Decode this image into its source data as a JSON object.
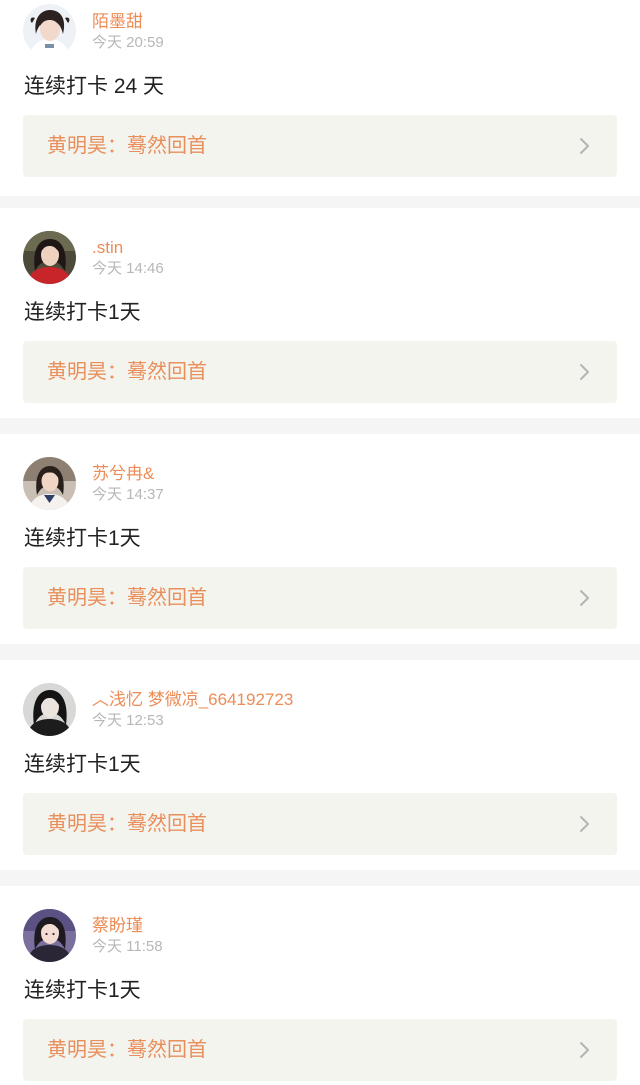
{
  "posts": [
    {
      "username": "陌墨甜",
      "time": "今天 20:59",
      "content": "连续打卡 24 天",
      "book": "黄明昊：蓦然回首",
      "avatar_icon": "avatar-girl-white-shirt"
    },
    {
      "username": ".stin",
      "time": "今天 14:46",
      "content": "连续打卡1天",
      "book": "黄明昊：蓦然回首",
      "avatar_icon": "avatar-girl-red-top"
    },
    {
      "username": "苏兮冉&",
      "time": "今天 14:37",
      "content": "连续打卡1天",
      "book": "黄明昊：蓦然回首",
      "avatar_icon": "avatar-girl-school"
    },
    {
      "username": "︿浅忆 梦微凉_664192723",
      "time": "今天 12:53",
      "content": "连续打卡1天",
      "book": "黄明昊：蓦然回首",
      "avatar_icon": "avatar-girl-dark"
    },
    {
      "username": "蔡盼瑾",
      "time": "今天 11:58",
      "content": "连续打卡1天",
      "book": "黄明昊：蓦然回首",
      "avatar_icon": "avatar-girl-purple"
    }
  ],
  "colors": {
    "accent": "#ec8d57",
    "book_bg": "#f4f4ef",
    "separator": "#f5f5f5",
    "meta": "#b7b7b7"
  }
}
